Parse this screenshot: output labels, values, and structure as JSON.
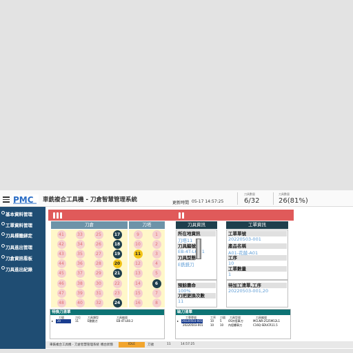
{
  "header": {
    "title": "車銑複合工具機 - 刀倉智慧管理系統",
    "update_label": "更新時間",
    "update_time": "05-17 14:57:25",
    "stat1_label": "刀具數量",
    "stat1_value": "6/32",
    "stat2_label": "刀具數量",
    "stat2_value": "26(81%)"
  },
  "sidebar": {
    "items": [
      {
        "label": "基本資料管理"
      },
      {
        "label": "工單資料管理"
      },
      {
        "label": "刀具標籤綁定"
      },
      {
        "label": "刀具進出管理"
      },
      {
        "label": "刀倉資訊看板"
      },
      {
        "label": "刀具進出紀錄"
      }
    ]
  },
  "magazine": {
    "title": "刀倉",
    "rows": [
      [
        {
          "n": "41",
          "s": "empty"
        },
        {
          "n": "33",
          "s": "empty"
        },
        {
          "n": "25",
          "s": "empty"
        },
        {
          "n": "17",
          "s": "filled"
        }
      ],
      [
        {
          "n": "42",
          "s": "empty"
        },
        {
          "n": "34",
          "s": "empty"
        },
        {
          "n": "26",
          "s": "empty"
        },
        {
          "n": "18",
          "s": "filled"
        }
      ],
      [
        {
          "n": "43",
          "s": "empty"
        },
        {
          "n": "35",
          "s": "empty"
        },
        {
          "n": "27",
          "s": "empty"
        },
        {
          "n": "19",
          "s": "filled"
        }
      ],
      [
        {
          "n": "44",
          "s": "empty"
        },
        {
          "n": "36",
          "s": "empty"
        },
        {
          "n": "28",
          "s": "empty"
        },
        {
          "n": "20",
          "s": "active"
        }
      ],
      [
        {
          "n": "45",
          "s": "empty"
        },
        {
          "n": "37",
          "s": "empty"
        },
        {
          "n": "29",
          "s": "empty"
        },
        {
          "n": "21",
          "s": "filled"
        }
      ],
      [
        {
          "n": "46",
          "s": "empty"
        },
        {
          "n": "38",
          "s": "empty"
        },
        {
          "n": "30",
          "s": "empty"
        },
        {
          "n": "22",
          "s": "empty"
        }
      ],
      [
        {
          "n": "47",
          "s": "empty"
        },
        {
          "n": "39",
          "s": "empty"
        },
        {
          "n": "31",
          "s": "empty"
        },
        {
          "n": "23",
          "s": "empty"
        }
      ],
      [
        {
          "n": "48",
          "s": "empty"
        },
        {
          "n": "40",
          "s": "empty"
        },
        {
          "n": "32",
          "s": "empty"
        },
        {
          "n": "24",
          "s": "filled"
        }
      ]
    ]
  },
  "turret": {
    "title": "刀塔",
    "cells": [
      {
        "n": "9",
        "s": "empty"
      },
      {
        "n": "1",
        "s": "empty"
      },
      {
        "n": "10",
        "s": "empty"
      },
      {
        "n": "2",
        "s": "empty"
      },
      {
        "n": "11",
        "s": "active"
      },
      {
        "n": "3",
        "s": "empty"
      },
      {
        "n": "12",
        "s": "empty"
      },
      {
        "n": "4",
        "s": "empty"
      },
      {
        "n": "13",
        "s": "empty"
      },
      {
        "n": "5",
        "s": "empty"
      },
      {
        "n": "14",
        "s": "empty"
      },
      {
        "n": "6",
        "s": "filled"
      },
      {
        "n": "15",
        "s": "empty"
      },
      {
        "n": "7",
        "s": "empty"
      },
      {
        "n": "16",
        "s": "empty"
      },
      {
        "n": "8",
        "s": "empty"
      }
    ]
  },
  "tool_info": {
    "title": "刀具資訊",
    "fields": [
      {
        "label": "所在地資訊",
        "value": "刀塔11"
      },
      {
        "label": "刀具編號",
        "value": "EB-4T-L60.1"
      },
      {
        "label": "刀具型態",
        "value": "E銑銑刀"
      }
    ],
    "life_label": "預餘壽命",
    "life_value": "100%",
    "swap_label": "刀把更換次數",
    "swap_value": "11"
  },
  "order_info": {
    "title": "工單資訊",
    "fields": [
      {
        "label": "工單單號",
        "value": "20220503-001"
      },
      {
        "label": "產品名稱",
        "value": "A01-花鼓-A01"
      },
      {
        "label": "工序",
        "value": "10"
      },
      {
        "label": "工單數量",
        "value": "1"
      }
    ],
    "pending_label": "待加工清單,工序",
    "pending_value": "20220503-001,20"
  },
  "swap_table": {
    "title": "待換刀清單",
    "columns": [
      "刀號",
      "刀位",
      "刀具類型",
      "刀具編號"
    ],
    "rows": [
      [
        "20",
        "11",
        "E銑銑刀",
        "EB-4T-L60.2"
      ]
    ]
  },
  "missing_table": {
    "title": "缺刀清單",
    "columns": [
      "工單單號",
      "工序",
      "刀號",
      "刀具型號",
      "刀具編號"
    ],
    "rows": [
      [
        "20220503-001",
        "10",
        "5",
        "OS外徑車刀",
        "MCLNR-2525M12L1"
      ],
      [
        "20220503-001",
        "10",
        "10",
        "內徑螺車刀",
        "C16Q-SDUCR11.5"
      ]
    ]
  },
  "status_bar": {
    "machine": "車銑複合工具機 - 刀倉智慧管理系統",
    "status_label": "機台狀態",
    "status_value": "IDLE",
    "turret_label": "刀號",
    "turret_value": "11",
    "time": "14:57:25"
  },
  "colors": {
    "header_red": "#e05a5a",
    "sidebar": "#1f4d73",
    "tool_filled": "#1f3f4c",
    "tool_empty": "#f6cfcf",
    "tool_active": "#f2c418",
    "table_header": "#0d7374"
  }
}
